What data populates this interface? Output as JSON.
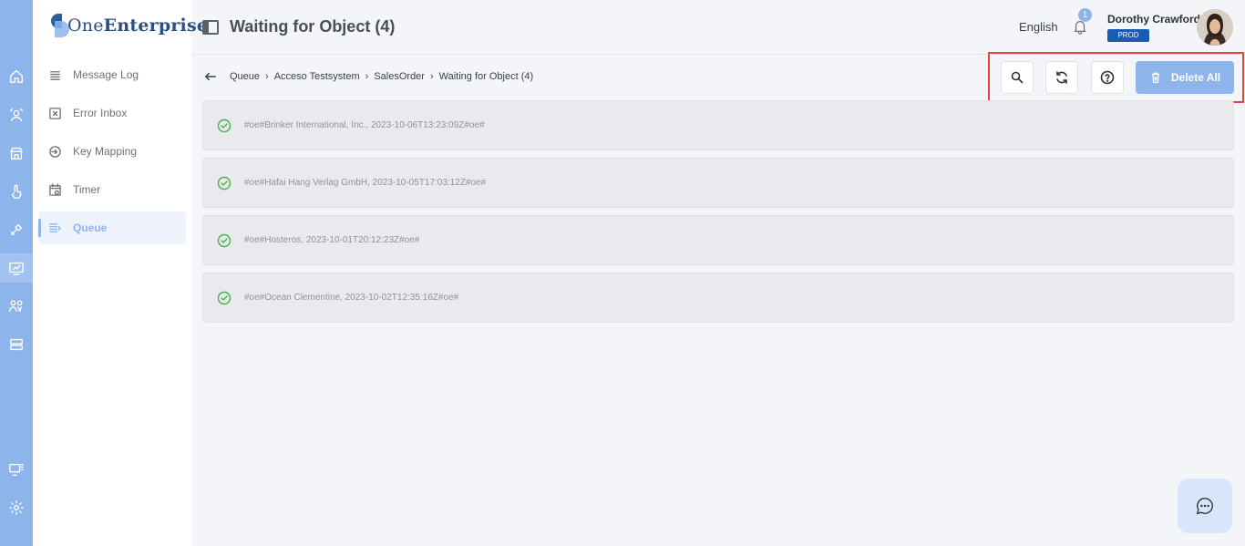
{
  "app": {
    "logo_light": "One",
    "logo_bold": "Enterprise"
  },
  "rail": {
    "icons": [
      "home-icon",
      "user-sync-icon",
      "store-icon",
      "touch-icon",
      "tools-icon",
      "monitor-chart-icon",
      "people-icon",
      "server-icon",
      "desktop-grid-icon",
      "settings-icon"
    ]
  },
  "sidebar": {
    "items": [
      {
        "label": "Message Log",
        "icon": "list-icon"
      },
      {
        "label": "Error Inbox",
        "icon": "error-inbox-icon"
      },
      {
        "label": "Key Mapping",
        "icon": "key-icon"
      },
      {
        "label": "Timer",
        "icon": "timer-icon"
      },
      {
        "label": "Queue",
        "icon": "queue-icon",
        "active": true
      }
    ]
  },
  "header": {
    "title": "Waiting for Object (4)",
    "language": "English",
    "notification_count": "1",
    "user_name": "Dorothy Crawford",
    "environment": "PROD"
  },
  "breadcrumb": [
    "Queue",
    "Acceso Testsystem",
    "SalesOrder",
    "Waiting for Object (4)"
  ],
  "toolbar": {
    "delete_all_label": "Delete All",
    "icons": [
      "search-icon",
      "refresh-icon",
      "help-icon",
      "trash-icon"
    ]
  },
  "queue_items": [
    "#oe#Brinker International, Inc., 2023-10-06T13:23:09Z#oe#",
    "#oe#Hafai Hang Verlag GmbH, 2023-10-05T17:03:12Z#oe#",
    "#oe#Hosteros, 2023-10-01T20:12:23Z#oe#",
    "#oe#Ocean Clementine, 2023-10-02T12:35:16Z#oe#"
  ],
  "colors": {
    "accent": "#8db5ec",
    "badge": "#1a5bb5",
    "success": "#4caf50",
    "highlight": "#e04444"
  }
}
